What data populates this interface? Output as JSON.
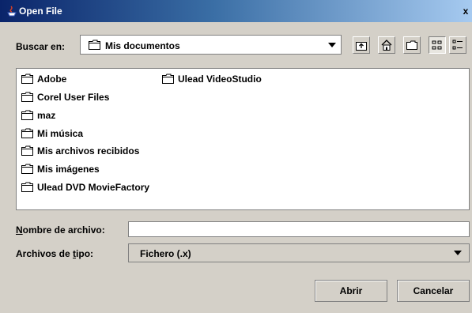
{
  "window": {
    "title": "Open File",
    "close_label": "x"
  },
  "lookin": {
    "label": "Buscar en:",
    "value": "Mis documentos"
  },
  "toolbar": {
    "icons": [
      "up-folder-icon",
      "home-icon",
      "new-folder-icon",
      "list-view-icon",
      "details-view-icon"
    ]
  },
  "files": [
    "Adobe",
    "Corel User Files",
    "maz",
    "Mi música",
    "Mis archivos recibidos",
    "Mis imágenes",
    "Ulead DVD MovieFactory",
    "Ulead VideoStudio"
  ],
  "filename": {
    "label_prefix": "",
    "label_underline": "N",
    "label_rest": "ombre de archivo:",
    "value": ""
  },
  "filetype": {
    "label_prefix": "Archivos de ",
    "label_underline": "t",
    "label_rest": "ipo:",
    "value": "Fichero (.x)"
  },
  "buttons": {
    "open": "Abrir",
    "cancel": "Cancelar"
  },
  "colors": {
    "title_start": "#0a246a",
    "title_end": "#a6caf0",
    "face": "#d4d0c8"
  }
}
